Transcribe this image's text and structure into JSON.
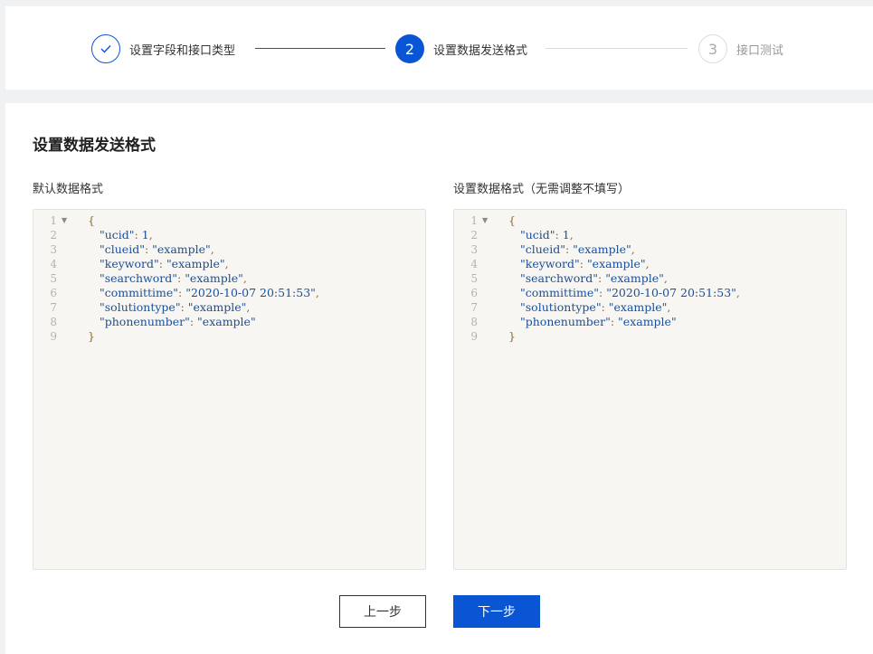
{
  "steps": [
    {
      "number": "1",
      "label": "设置字段和接口类型",
      "state": "done"
    },
    {
      "number": "2",
      "label": "设置数据发送格式",
      "state": "active"
    },
    {
      "number": "3",
      "label": "接口测试",
      "state": "pending"
    }
  ],
  "main": {
    "title": "设置数据发送格式",
    "left_editor_label": "默认数据格式",
    "right_editor_label": "设置数据格式（无需调整不填写）"
  },
  "editor_lines": [
    {
      "n": "1",
      "fold": true,
      "tokens": [
        [
          "punct",
          "{"
        ]
      ],
      "indent": 0
    },
    {
      "n": "2",
      "tokens": [
        [
          "key",
          "\"ucid\""
        ],
        [
          "punct",
          ": "
        ],
        [
          "num",
          "1"
        ],
        [
          "punct",
          ","
        ]
      ],
      "indent": 1
    },
    {
      "n": "3",
      "tokens": [
        [
          "key",
          "\"clueid\""
        ],
        [
          "punct",
          ": "
        ],
        [
          "str",
          "\"example\""
        ],
        [
          "punct",
          ","
        ]
      ],
      "indent": 1
    },
    {
      "n": "4",
      "tokens": [
        [
          "key",
          "\"keyword\""
        ],
        [
          "punct",
          ": "
        ],
        [
          "str",
          "\"example\""
        ],
        [
          "punct",
          ","
        ]
      ],
      "indent": 1
    },
    {
      "n": "5",
      "tokens": [
        [
          "key",
          "\"searchword\""
        ],
        [
          "punct",
          ": "
        ],
        [
          "str",
          "\"example\""
        ],
        [
          "punct",
          ","
        ]
      ],
      "indent": 1
    },
    {
      "n": "6",
      "tokens": [
        [
          "key",
          "\"committime\""
        ],
        [
          "punct",
          ": "
        ],
        [
          "str",
          "\"2020-10-07 20:51:53\""
        ],
        [
          "punct",
          ","
        ]
      ],
      "indent": 1
    },
    {
      "n": "7",
      "tokens": [
        [
          "key",
          "\"solutiontype\""
        ],
        [
          "punct",
          ": "
        ],
        [
          "str",
          "\"example\""
        ],
        [
          "punct",
          ","
        ]
      ],
      "indent": 1
    },
    {
      "n": "8",
      "tokens": [
        [
          "key",
          "\"phonenumber\""
        ],
        [
          "punct",
          ": "
        ],
        [
          "str",
          "\"example\""
        ]
      ],
      "indent": 1
    },
    {
      "n": "9",
      "tokens": [
        [
          "punct",
          "}"
        ]
      ],
      "indent": 0
    }
  ],
  "buttons": {
    "prev": "上一步",
    "next": "下一步"
  },
  "colors": {
    "accent": "#0a55d4",
    "editor_bg": "#f7f6f2"
  }
}
